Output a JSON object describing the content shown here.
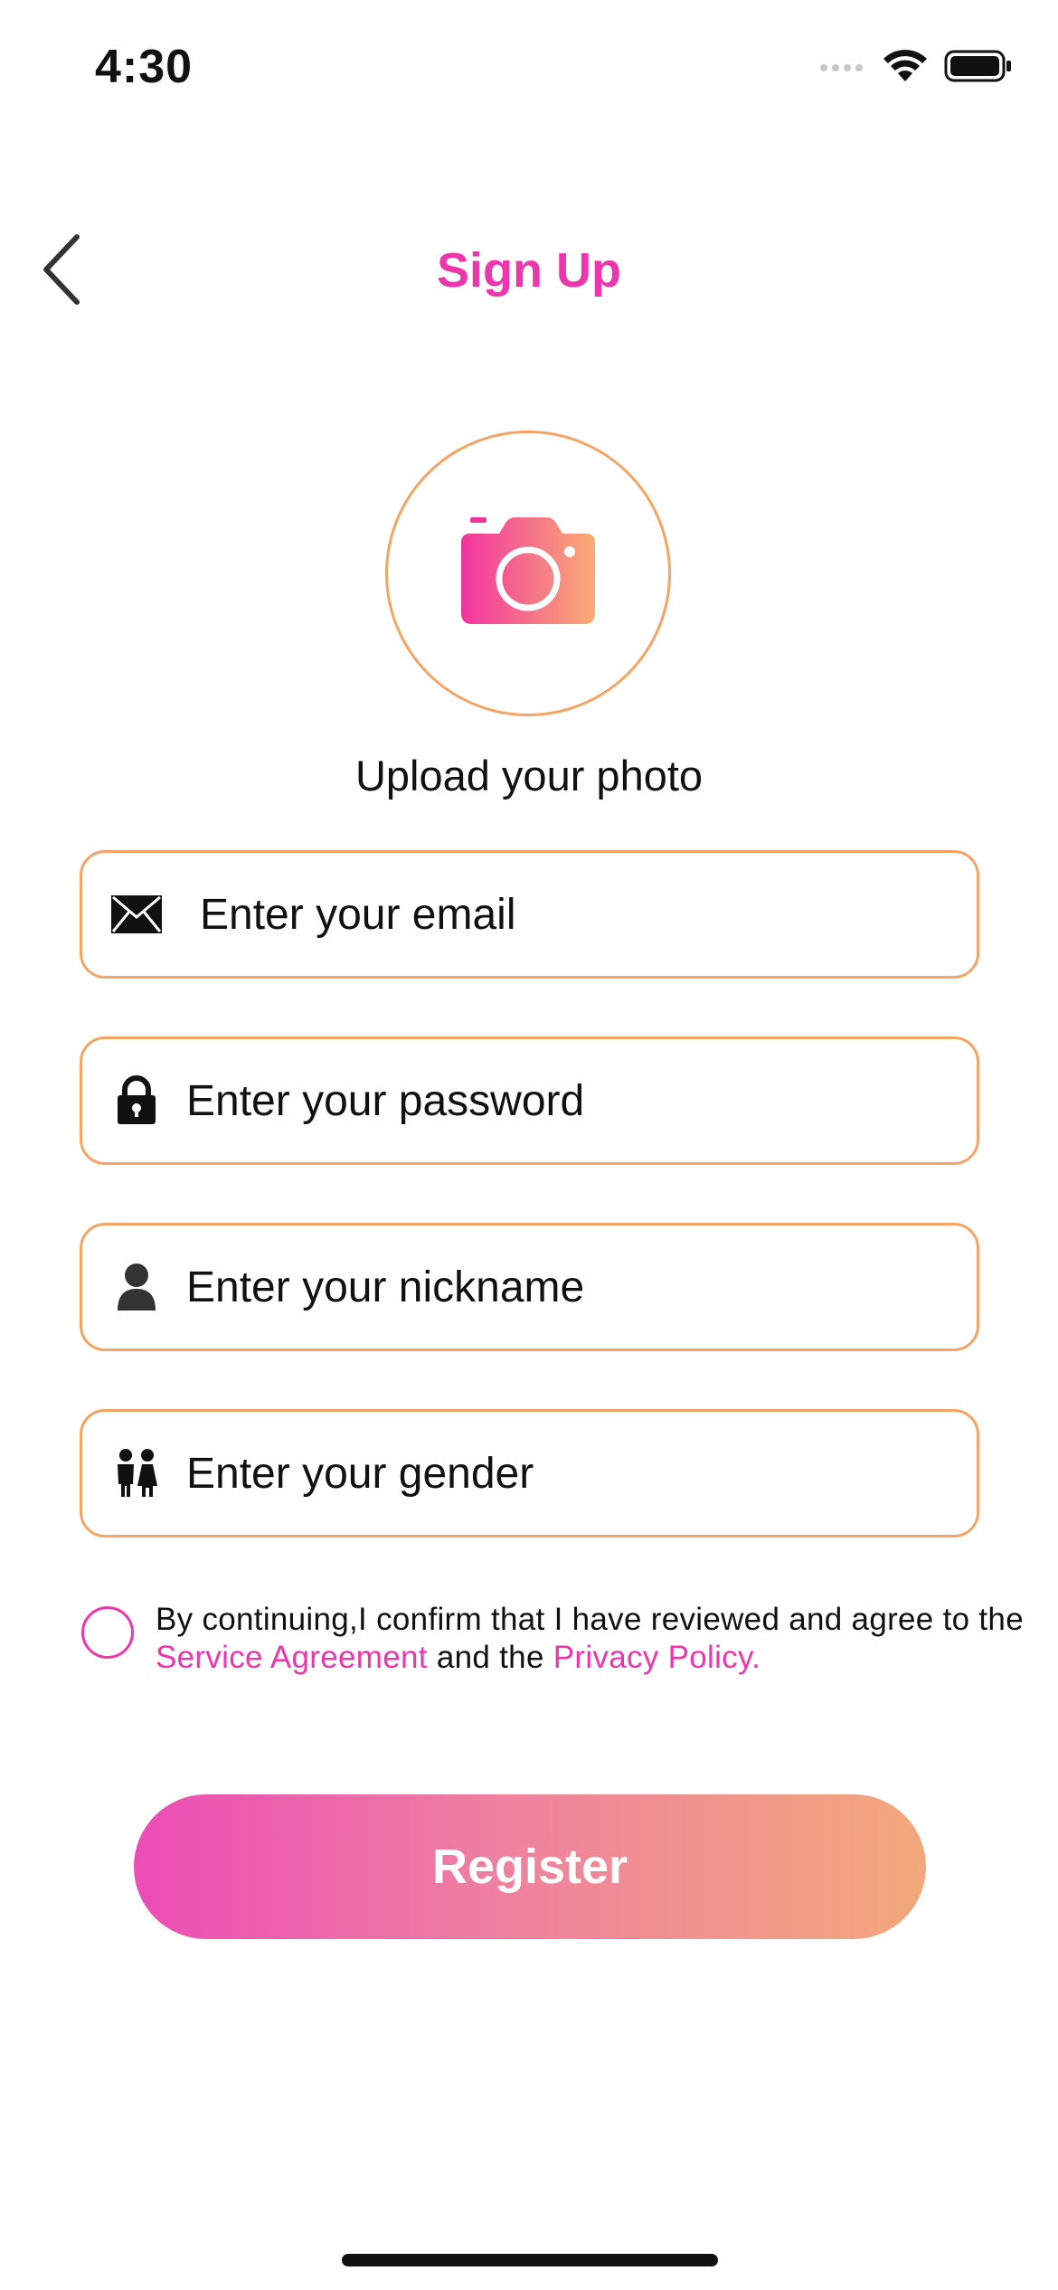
{
  "status_bar": {
    "time": "4:30"
  },
  "nav": {
    "back_icon": "chevron-left-icon",
    "title": "Sign Up"
  },
  "photo": {
    "icon": "camera-icon",
    "label": "Upload your photo"
  },
  "fields": {
    "email": {
      "icon": "envelope-icon",
      "placeholder": "Enter your email",
      "value": ""
    },
    "password": {
      "icon": "lock-icon",
      "placeholder": "Enter your password",
      "value": ""
    },
    "nickname": {
      "icon": "person-icon",
      "placeholder": "Enter your nickname",
      "value": ""
    },
    "gender": {
      "icon": "people-icon",
      "placeholder": "Enter your gender",
      "value": ""
    }
  },
  "agreement": {
    "checked": false,
    "text_before": "By continuing,I confirm that I have reviewed and agree to the ",
    "service_link": "Service Agreement",
    "text_middle": " and the ",
    "privacy_link": "Privacy Policy."
  },
  "register": {
    "label": "Register"
  },
  "colors": {
    "accent_pink": "#ee35ac",
    "accent_orange": "#f5a463",
    "gradient_start": "#ec4cb6",
    "gradient_end": "#f2a87a"
  }
}
